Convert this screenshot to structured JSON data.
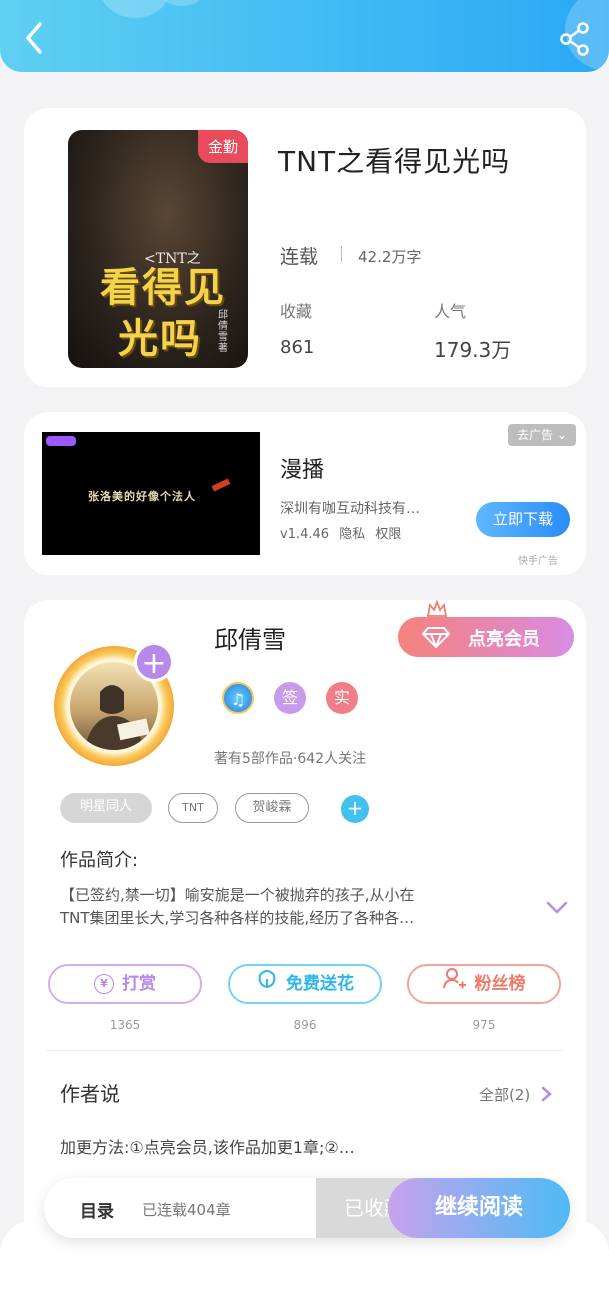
{
  "book": {
    "cover_badge": "金勤",
    "cover_title_small": "<TNT之",
    "cover_title_big_1": "看得见",
    "cover_title_big_2": "光吗",
    "cover_author": "邱倩雪 著",
    "title": "TNT之看得见光吗",
    "status": "连载",
    "word_count": "42.2万字",
    "favorites_label": "收藏",
    "favorites_value": "861",
    "popularity_label": "人气",
    "popularity_value": "179.3万"
  },
  "ad": {
    "go_ad_label": "去广告",
    "image_caption": "张洛美的好像个法人",
    "app_name": "漫播",
    "company": "深圳有咖互动科技有…",
    "version": "v1.4.46",
    "privacy": "隐私",
    "permission": "权限",
    "download_label": "立即下载",
    "source": "快手广告"
  },
  "author": {
    "name": "邱倩雪",
    "vip_label": "点亮会员",
    "badge_music": "♫",
    "badge_sign": "签",
    "badge_real": "实",
    "stats": "著有5部作品·642人关注",
    "tags": [
      "明星同人",
      "TNT",
      "贺峻霖"
    ],
    "tag_add": "+",
    "plus": "+"
  },
  "intro": {
    "label": "作品简介:",
    "line1": "【已签约,禁一切】喻安旎是一个被抛弃的孩子,从小在",
    "line2": "TNT集团里长大,学习各种各样的技能,经历了各种各…"
  },
  "actions": [
    {
      "label": "打赏",
      "icon": "¥",
      "count": "1365"
    },
    {
      "label": "免费送花",
      "icon": "flower-icon",
      "count": "896"
    },
    {
      "label": "粉丝榜",
      "icon": "fans-icon",
      "count": "975"
    }
  ],
  "author_says": {
    "label": "作者说",
    "all_label": "全部(2)",
    "text": "加更方法:①点亮会员,该作品加更1章;②…"
  },
  "bottom": {
    "catalog_label": "目录",
    "catalog_status": "已连载404章",
    "collected_label": "已收藏",
    "continue_label": "继续阅读"
  },
  "colors": {
    "header_start": "#5fd0f2",
    "header_end": "#2aa8f5",
    "vip_start": "#f5817a",
    "vip_end": "#d98ce4",
    "tip": "#c79be9",
    "flower": "#42c0ee",
    "fans": "#f07e6e"
  }
}
